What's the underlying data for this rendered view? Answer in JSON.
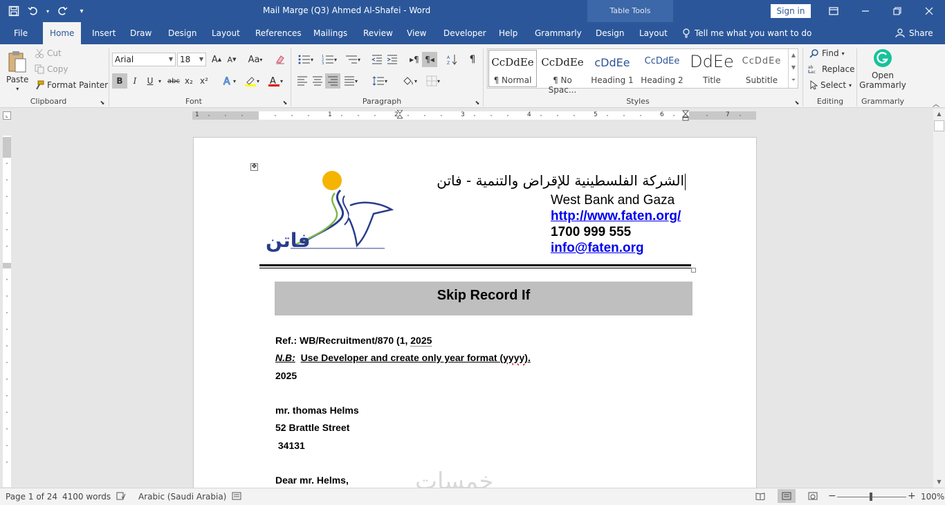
{
  "window": {
    "title": "Mail Marge (Q3) Ahmed Al-Shafei  -  Word",
    "context_tab_group": "Table Tools",
    "signin_label": "Sign in"
  },
  "tabs": [
    "File",
    "Home",
    "Insert",
    "Draw",
    "Design",
    "Layout",
    "References",
    "Mailings",
    "Review",
    "View",
    "Developer",
    "Help",
    "Grammarly",
    "Design",
    "Layout"
  ],
  "active_tab": "Home",
  "tell_me": "Tell me what you want to do",
  "share_label": "Share",
  "ribbon": {
    "clipboard": {
      "paste": "Paste",
      "cut": "Cut",
      "copy": "Copy",
      "format_painter": "Format Painter",
      "label": "Clipboard"
    },
    "font": {
      "font_name": "Arial",
      "font_size": "18",
      "label": "Font",
      "bold": "B",
      "italic": "I",
      "underline": "U",
      "strike": "abc",
      "subscript": "x₂",
      "superscript": "x²",
      "grow": "A",
      "shrink": "A",
      "case": "Aa"
    },
    "paragraph": {
      "label": "Paragraph"
    },
    "styles": {
      "label": "Styles",
      "items": [
        {
          "sample": "CcDdEe",
          "name": "¶ Normal"
        },
        {
          "sample": "CcDdEe",
          "name": "¶ No Spac..."
        },
        {
          "sample": "cDdEe",
          "name": "Heading 1"
        },
        {
          "sample": "CcDdEe",
          "name": "Heading 2"
        },
        {
          "sample": "DdEe",
          "name": "Title"
        },
        {
          "sample": "CcDdEe",
          "name": "Subtitle"
        }
      ]
    },
    "editing": {
      "label": "Editing",
      "find": "Find",
      "replace": "Replace",
      "select": "Select"
    },
    "grammarly": {
      "label": "Grammarly",
      "open_line1": "Open",
      "open_line2": "Grammarly"
    }
  },
  "ruler": {
    "numbers": [
      "1",
      "1",
      "2",
      "3",
      "4",
      "5",
      "6",
      "7"
    ]
  },
  "document": {
    "arabic_title": "الشركة الفلسطينية للإقراض والتنمية - فاتن",
    "logo_text": "فاتن",
    "region": "West Bank and Gaza",
    "website": "http://www.faten.org/",
    "phone": "1700 999 555",
    "email": "info@faten.org",
    "skip_title": "Skip Record If",
    "ref": "Ref.:  WB/Recruitment/870 (1, ",
    "ref_year": "2025",
    "nb_label": "N.B:",
    "nb_text_1": "Use Developer and create only year format (",
    "nb_text_wavy": "yyyy",
    "nb_text_2": ").",
    "year_line": "2025",
    "name_line": "mr. thomas Helms",
    "street_line": "52 Brattle Street",
    "zip_line": " 34131",
    "greeting": "Dear mr. Helms,"
  },
  "watermark": "خمسات",
  "status": {
    "page": "Page 1 of 24",
    "words": "4100 words",
    "language": "Arabic (Saudi Arabia)",
    "zoom": "100%"
  },
  "colors": {
    "accent": "#2b579a",
    "link": "#0000ee",
    "skip_box": "#bfbfbf"
  }
}
